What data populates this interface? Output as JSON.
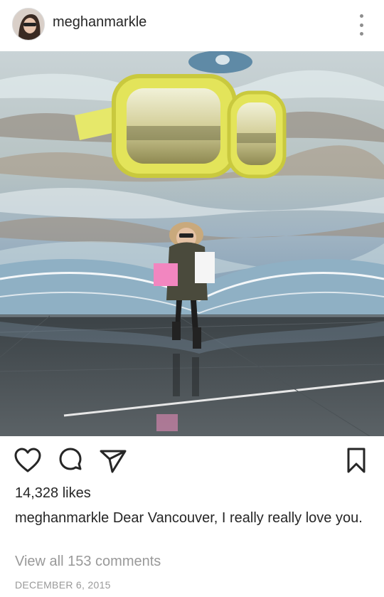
{
  "post": {
    "username": "meghanmarkle",
    "likes": "14,328 likes",
    "caption_user": "meghanmarkle",
    "caption_text": " Dear Vancouver, I really really love you.",
    "view_comments": "View all 153 comments",
    "date": "DECEMBER 6, 2015"
  },
  "icons": {
    "more": "more-vertical-icon",
    "like": "heart-icon",
    "comment": "comment-icon",
    "share": "send-icon",
    "save": "bookmark-icon"
  },
  "colors": {
    "text": "#262626",
    "muted": "#999999",
    "icon": "#262626"
  }
}
